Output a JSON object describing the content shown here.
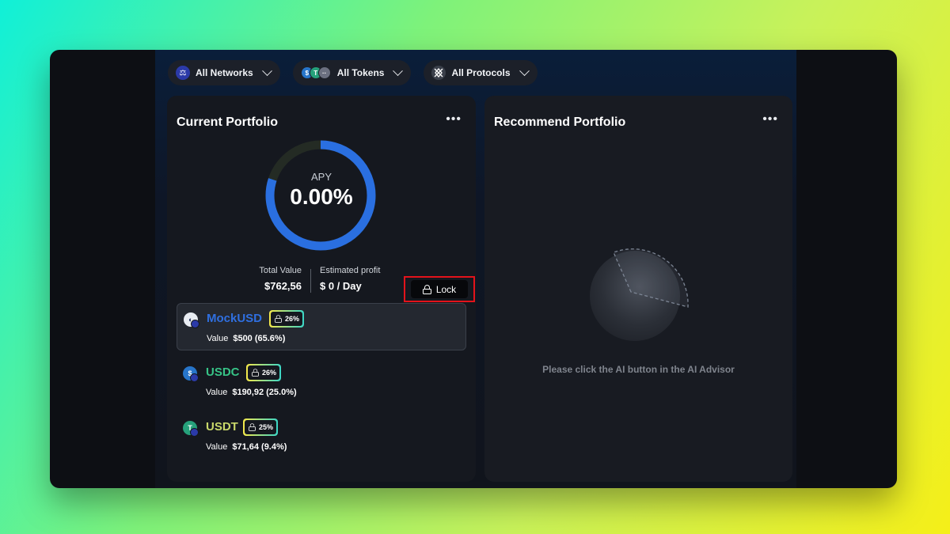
{
  "filters": {
    "networks": "All Networks",
    "tokens": "All Tokens",
    "protocols": "All Protocols"
  },
  "current": {
    "title": "Current Portfolio",
    "menu": "•••",
    "apy_label": "APY",
    "apy_value": "0.00%",
    "total_label": "Total Value",
    "total_value": "$762,56",
    "profit_label": "Estimated profit",
    "profit_value": "$ 0 / Day",
    "lock_label": "Lock",
    "assets": [
      {
        "name": "MockUSD",
        "apy": "26%",
        "value_label": "Value",
        "value": "$500 (65.6%)",
        "color": "#2f6fe0"
      },
      {
        "name": "USDC",
        "apy": "26%",
        "value_label": "Value",
        "value": "$190,92 (25.0%)",
        "color": "#37c487"
      },
      {
        "name": "USDT",
        "apy": "25%",
        "value_label": "Value",
        "value": "$71,64 (9.4%)",
        "color": "#c9d86a"
      }
    ]
  },
  "recommend": {
    "title": "Recommend Portfolio",
    "menu": "•••",
    "hint": "Please click the AI button in the AI Advisor"
  },
  "colors": {
    "accent": "#2f6fe0",
    "highlight": "#e3131b"
  }
}
